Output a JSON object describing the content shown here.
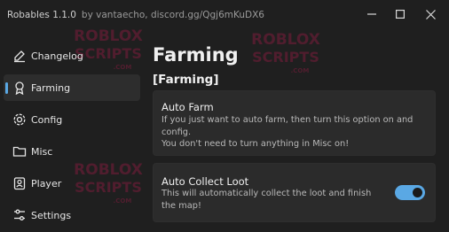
{
  "window": {
    "title": "Robables 1.1.0",
    "subtitle": "by vantaecho, discord.gg/Qgj6mKuDX6",
    "controls": [
      "minimize-icon",
      "maximize-icon",
      "close-icon"
    ]
  },
  "watermark": {
    "line1": "ROBLOX",
    "line2": "SCRIPTS",
    "line3": ".COM"
  },
  "sidebar": {
    "items": [
      {
        "label": "Changelog",
        "icon": "changelog-icon"
      },
      {
        "label": "Farming",
        "icon": "farming-icon",
        "active": true
      },
      {
        "label": "Config",
        "icon": "gear-icon"
      },
      {
        "label": "Misc",
        "icon": "folder-icon"
      },
      {
        "label": "Player",
        "icon": "player-icon"
      },
      {
        "label": "Settings",
        "icon": "settings-icon"
      }
    ]
  },
  "main": {
    "title": "Farming",
    "section": "[Farming]",
    "cards": [
      {
        "title": "Auto Farm",
        "desc": "If you just want to auto farm, then turn this option on and config.",
        "desc2": "You don't need to turn anything in Misc on!"
      },
      {
        "title": "Auto Collect Loot",
        "desc": "This will automatically collect the loot and finish the map!",
        "toggle_on": true
      }
    ]
  },
  "colors": {
    "accent": "#5aa8e4",
    "background": "#1f1f1f",
    "card": "#2b2b2b"
  }
}
